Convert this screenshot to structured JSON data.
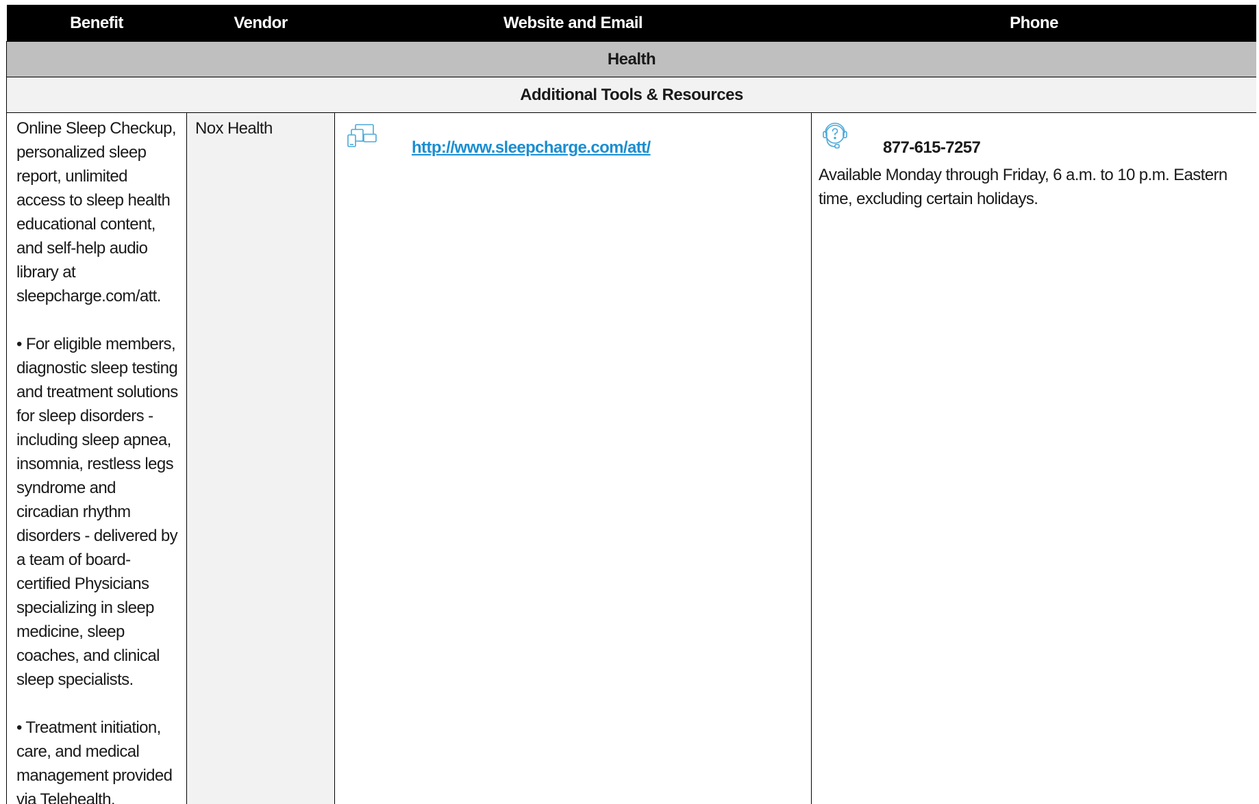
{
  "table": {
    "headers": {
      "benefit": "Benefit",
      "vendor": "Vendor",
      "website": "Website and Email",
      "phone": "Phone"
    },
    "section": "Health",
    "subsection": "Additional Tools & Resources",
    "rows": [
      {
        "benefit_paragraphs": [
          "Online Sleep Checkup, personalized sleep report, unlimited access to sleep health educational content, and self-help audio library at sleepcharge.com/att.",
          "• For eligible members, diagnostic sleep testing and treatment solutions for sleep disorders - including sleep apnea, insomnia, restless legs syndrome and circadian rhythm disorders - delivered by a team of board-certified Physicians specializing in sleep medicine, sleep coaches, and clinical sleep specialists.",
          "• Treatment initiation, care, and medical management provided via Telehealth."
        ],
        "vendor": "Nox Health",
        "website_icon": "devices-icon",
        "website_url": "http://www.sleepcharge.com/att/",
        "phone_icon": "headset-help-icon",
        "phone_number": "877-615-7257",
        "phone_hours": "Available Monday through Friday, 6 a.m. to 10 p.m. Eastern time, excluding certain holidays."
      }
    ]
  },
  "colors": {
    "header_bg": "#000000",
    "section_bg": "#bfbfbf",
    "subsection_bg": "#f2f2f2",
    "link": "#1a8ed1",
    "icon": "#4aa8d8"
  }
}
